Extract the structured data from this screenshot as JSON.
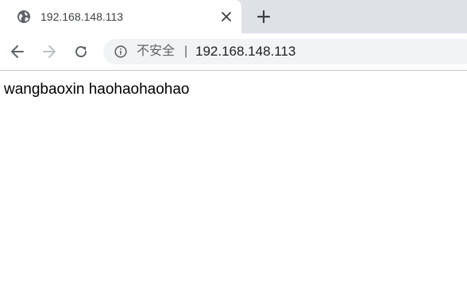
{
  "tab": {
    "title": "192.168.148.113",
    "favicon": "globe-icon",
    "close_icon": "close-icon"
  },
  "new_tab_icon": "plus-icon",
  "toolbar": {
    "back_icon": "arrow-left-icon",
    "forward_icon": "arrow-right-icon",
    "reload_icon": "reload-icon"
  },
  "omnibox": {
    "info_icon": "info-icon",
    "security_label": "不安全",
    "divider": "|",
    "url": "192.168.148.113"
  },
  "page": {
    "text": "wangbaoxin haohaohaohao"
  },
  "colors": {
    "tabstrip_bg": "#dee1e6",
    "omnibox_bg": "#f1f3f4",
    "icon_gray": "#5f6368",
    "disabled_gray": "#bdc1c6"
  }
}
